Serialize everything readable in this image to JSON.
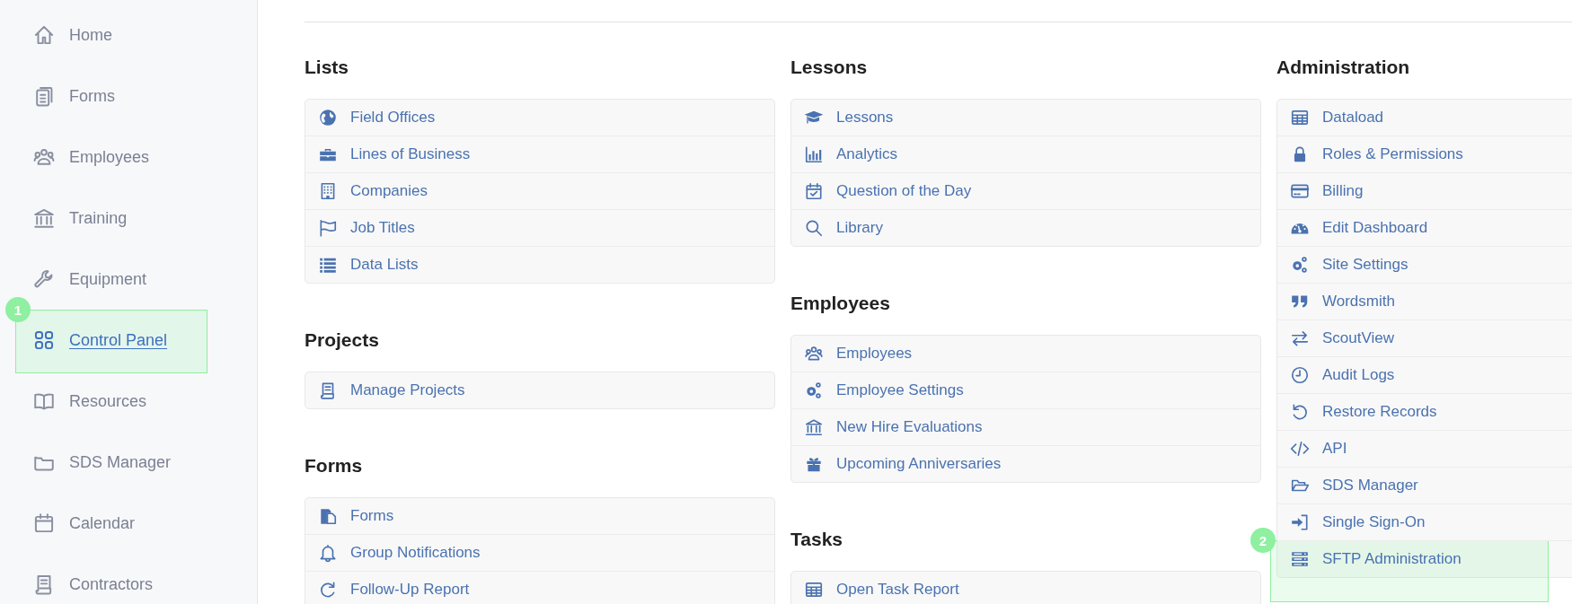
{
  "sidebar": {
    "items": [
      {
        "label": "Home",
        "selected": false
      },
      {
        "label": "Forms",
        "selected": false
      },
      {
        "label": "Employees",
        "selected": false
      },
      {
        "label": "Training",
        "selected": false
      },
      {
        "label": "Equipment",
        "selected": false
      },
      {
        "label": "Control Panel",
        "selected": true,
        "callout": "1"
      },
      {
        "label": "Resources",
        "selected": false
      },
      {
        "label": "SDS Manager",
        "selected": false
      },
      {
        "label": "Calendar",
        "selected": false
      },
      {
        "label": "Contractors",
        "selected": false
      }
    ]
  },
  "columns": [
    {
      "sections": [
        {
          "title": "Lists",
          "items": [
            {
              "label": "Field Offices"
            },
            {
              "label": "Lines of Business"
            },
            {
              "label": "Companies"
            },
            {
              "label": "Job Titles"
            },
            {
              "label": "Data Lists"
            }
          ]
        },
        {
          "title": "Projects",
          "items": [
            {
              "label": "Manage Projects"
            }
          ]
        },
        {
          "title": "Forms",
          "items": [
            {
              "label": "Forms"
            },
            {
              "label": "Group Notifications"
            },
            {
              "label": "Follow-Up Report"
            }
          ]
        }
      ]
    },
    {
      "sections": [
        {
          "title": "Lessons",
          "items": [
            {
              "label": "Lessons"
            },
            {
              "label": "Analytics"
            },
            {
              "label": "Question of the Day"
            },
            {
              "label": "Library"
            }
          ]
        },
        {
          "title": "Employees",
          "items": [
            {
              "label": "Employees"
            },
            {
              "label": "Employee Settings"
            },
            {
              "label": "New Hire Evaluations"
            },
            {
              "label": "Upcoming Anniversaries"
            }
          ]
        },
        {
          "title": "Tasks",
          "items": [
            {
              "label": "Open Task Report"
            }
          ]
        }
      ]
    },
    {
      "sections": [
        {
          "title": "Administration",
          "items": [
            {
              "label": "Dataload"
            },
            {
              "label": "Roles & Permissions"
            },
            {
              "label": "Billing"
            },
            {
              "label": "Edit Dashboard"
            },
            {
              "label": "Site Settings"
            },
            {
              "label": "Wordsmith"
            },
            {
              "label": "ScoutView"
            },
            {
              "label": "Audit Logs"
            },
            {
              "label": "Restore Records"
            },
            {
              "label": "API"
            },
            {
              "label": "SDS Manager"
            },
            {
              "label": "Single Sign-On"
            },
            {
              "label": "SFTP Administration",
              "callout": "2"
            }
          ]
        }
      ]
    }
  ]
}
